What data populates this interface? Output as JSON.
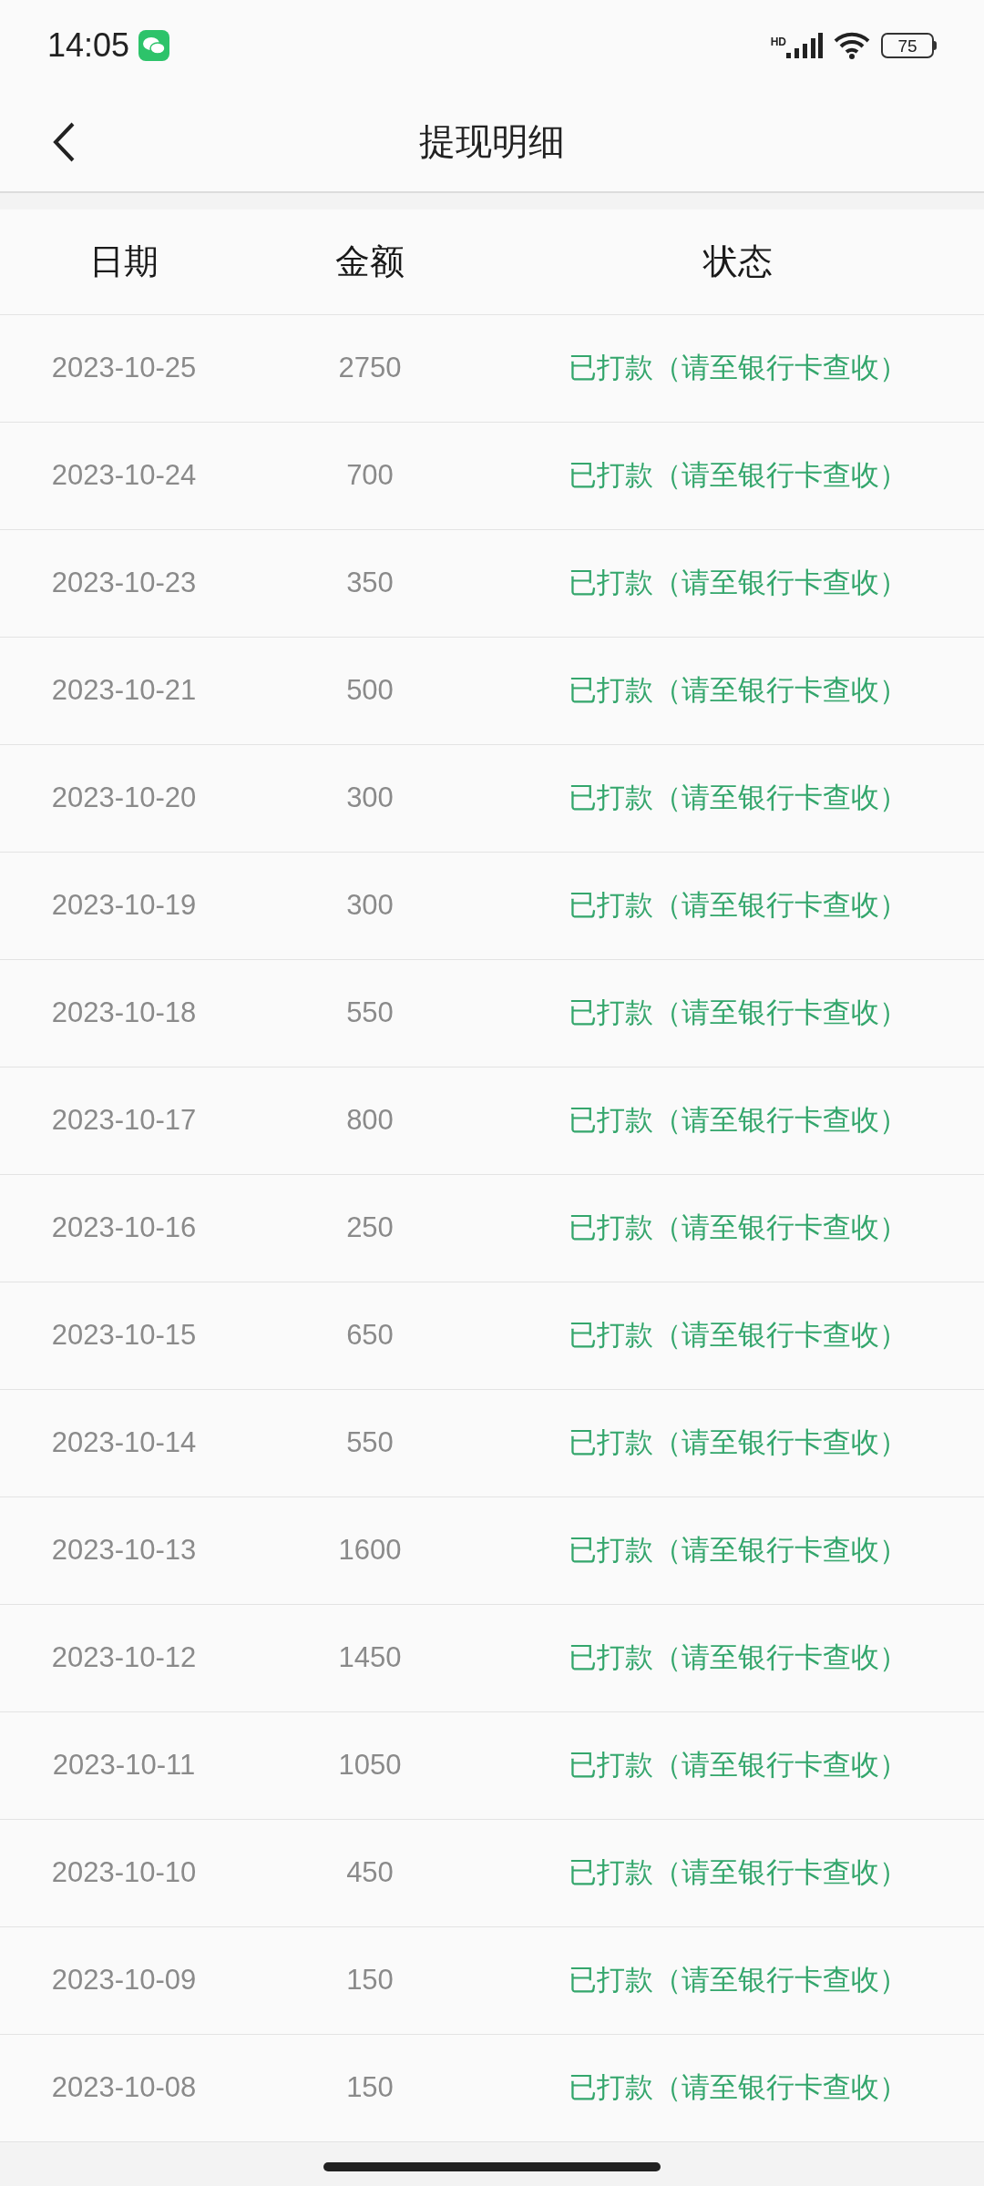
{
  "status_bar": {
    "time": "14:05",
    "network_label": "HD",
    "battery": "75"
  },
  "header": {
    "title": "提现明细"
  },
  "table": {
    "columns": [
      "日期",
      "金额",
      "状态"
    ],
    "rows": [
      {
        "date": "2023-10-25",
        "amount": "2750",
        "status": "已打款（请至银行卡查收）"
      },
      {
        "date": "2023-10-24",
        "amount": "700",
        "status": "已打款（请至银行卡查收）"
      },
      {
        "date": "2023-10-23",
        "amount": "350",
        "status": "已打款（请至银行卡查收）"
      },
      {
        "date": "2023-10-21",
        "amount": "500",
        "status": "已打款（请至银行卡查收）"
      },
      {
        "date": "2023-10-20",
        "amount": "300",
        "status": "已打款（请至银行卡查收）"
      },
      {
        "date": "2023-10-19",
        "amount": "300",
        "status": "已打款（请至银行卡查收）"
      },
      {
        "date": "2023-10-18",
        "amount": "550",
        "status": "已打款（请至银行卡查收）"
      },
      {
        "date": "2023-10-17",
        "amount": "800",
        "status": "已打款（请至银行卡查收）"
      },
      {
        "date": "2023-10-16",
        "amount": "250",
        "status": "已打款（请至银行卡查收）"
      },
      {
        "date": "2023-10-15",
        "amount": "650",
        "status": "已打款（请至银行卡查收）"
      },
      {
        "date": "2023-10-14",
        "amount": "550",
        "status": "已打款（请至银行卡查收）"
      },
      {
        "date": "2023-10-13",
        "amount": "1600",
        "status": "已打款（请至银行卡查收）"
      },
      {
        "date": "2023-10-12",
        "amount": "1450",
        "status": "已打款（请至银行卡查收）"
      },
      {
        "date": "2023-10-11",
        "amount": "1050",
        "status": "已打款（请至银行卡查收）"
      },
      {
        "date": "2023-10-10",
        "amount": "450",
        "status": "已打款（请至银行卡查收）"
      },
      {
        "date": "2023-10-09",
        "amount": "150",
        "status": "已打款（请至银行卡查收）"
      },
      {
        "date": "2023-10-08",
        "amount": "150",
        "status": "已打款（请至银行卡查收）"
      }
    ]
  }
}
